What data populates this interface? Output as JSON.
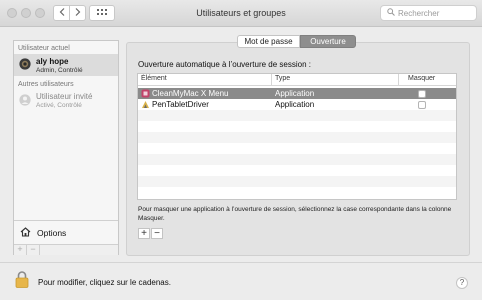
{
  "window": {
    "title": "Utilisateurs et groupes"
  },
  "search": {
    "placeholder": "Rechercher"
  },
  "sidebar": {
    "current_header": "Utilisateur actuel",
    "current_user": {
      "name": "aly hope",
      "role": "Admin, Contrôlé"
    },
    "others_header": "Autres utilisateurs",
    "guest_user": {
      "name": "Utilisateur invité",
      "role": "Activé, Contrôlé"
    },
    "options_label": "Options",
    "plus": "+",
    "minus": "−"
  },
  "tabs": [
    {
      "label": "Mot de passe",
      "selected": false
    },
    {
      "label": "Ouverture",
      "selected": true
    }
  ],
  "login_items": {
    "heading": "Ouverture automatique à l’ouverture de session :",
    "columns": [
      "Élément",
      "Type",
      "Masquer"
    ],
    "rows": [
      {
        "item": "CleanMyMac X Menu",
        "type": "Application",
        "hide": false,
        "selected": true
      },
      {
        "item": "PenTabletDriver",
        "type": "Application",
        "hide": false,
        "selected": false
      }
    ],
    "hint": "Pour masquer une application à l’ouverture de session, sélectionnez la case correspondante dans la colonne Masquer.",
    "plus": "+",
    "minus": "−"
  },
  "footer": {
    "lock_text": "Pour modifier, cliquez sur le cadenas.",
    "help": "?"
  },
  "colors": {
    "selection": "#8a8a8a",
    "tab_selected": "#8e8e8e"
  }
}
